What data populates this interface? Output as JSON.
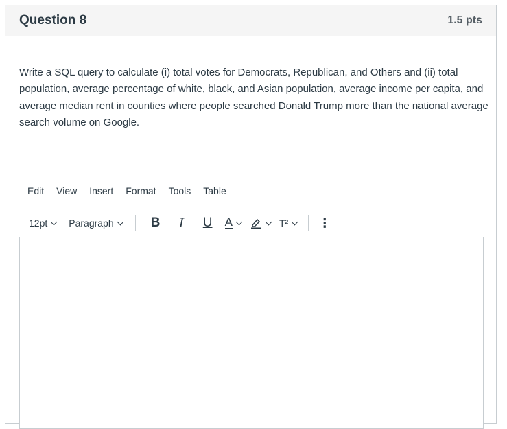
{
  "question": {
    "title": "Question 8",
    "points": "1.5 pts",
    "text": "Write a SQL query to calculate (i) total votes for Democrats, Republican, and Others and (ii) total population, average percentage of white, black, and Asian population, average income per capita, and average median rent in counties where people searched Donald Trump more than the national average search volume on Google."
  },
  "editor": {
    "menu": [
      "Edit",
      "View",
      "Insert",
      "Format",
      "Tools",
      "Table"
    ],
    "font_size": "12pt",
    "block_format": "Paragraph",
    "bold": "B",
    "italic": "I",
    "underline": "U",
    "text_color": "A",
    "superscript_label": "T²",
    "more": "⋮",
    "content": ""
  },
  "colors": {
    "header_bg": "#f5f5f5",
    "border": "#c7cdd1",
    "text": "#2d3b45"
  }
}
